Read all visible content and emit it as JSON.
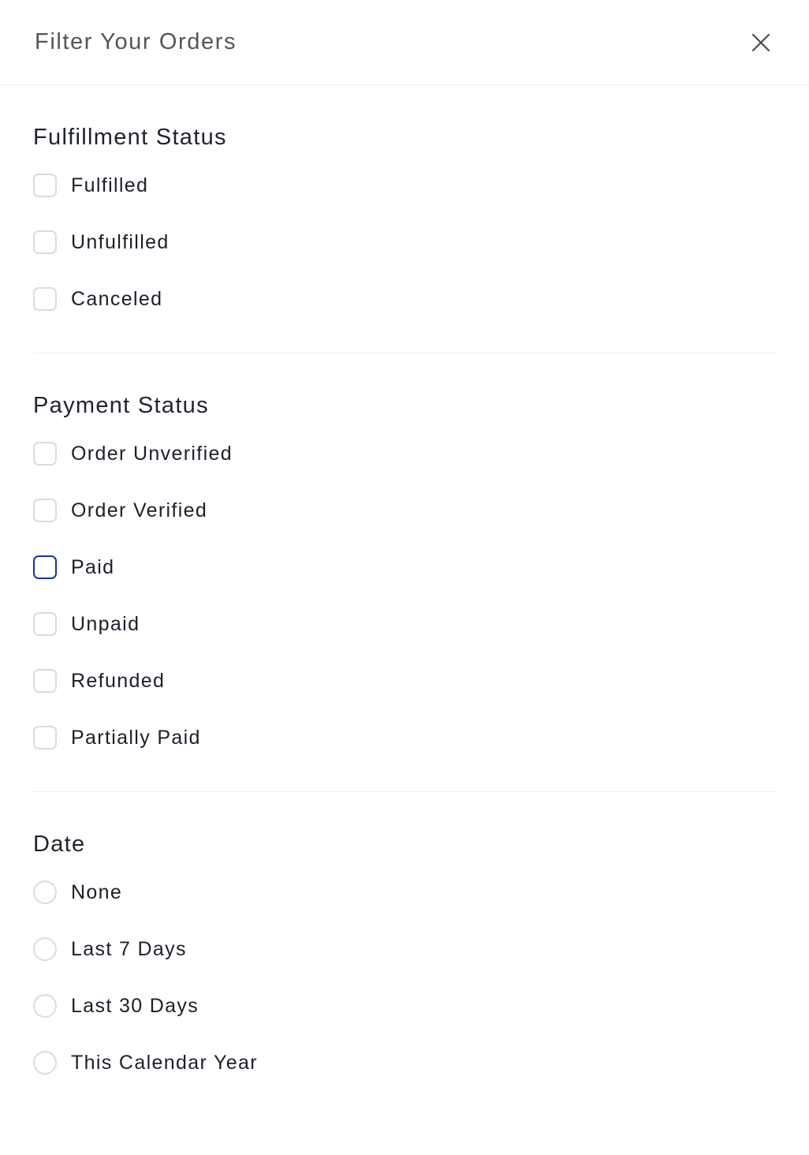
{
  "header": {
    "title": "Filter Your Orders",
    "close_icon": "close-icon",
    "close_label": "X"
  },
  "sections": [
    {
      "id": "fulfillment-status",
      "heading": "Fulfillment Status",
      "control_type": "checkbox",
      "options": [
        {
          "label": "Fulfilled",
          "checked": false,
          "focused": false
        },
        {
          "label": "Unfulfilled",
          "checked": false,
          "focused": false
        },
        {
          "label": "Canceled",
          "checked": false,
          "focused": false
        }
      ]
    },
    {
      "id": "payment-status",
      "heading": "Payment Status",
      "control_type": "checkbox",
      "options": [
        {
          "label": "Order Unverified",
          "checked": false,
          "focused": false
        },
        {
          "label": "Order Verified",
          "checked": false,
          "focused": false
        },
        {
          "label": "Paid",
          "checked": false,
          "focused": true
        },
        {
          "label": "Unpaid",
          "checked": false,
          "focused": false
        },
        {
          "label": "Refunded",
          "checked": false,
          "focused": false
        },
        {
          "label": "Partially Paid",
          "checked": false,
          "focused": false
        }
      ]
    },
    {
      "id": "date",
      "heading": "Date",
      "control_type": "radio",
      "options": [
        {
          "label": "None",
          "selected": false
        },
        {
          "label": "Last 7 Days",
          "selected": false
        },
        {
          "label": "Last 30 Days",
          "selected": false
        },
        {
          "label": "This Calendar Year",
          "selected": false
        }
      ]
    }
  ],
  "colors": {
    "focus_border": "#1a31a0",
    "control_border": "#dcdcdc",
    "divider": "#ececec",
    "title_text": "#555555",
    "heading_text": "#1f232d",
    "label_text": "#1b1f2a"
  }
}
